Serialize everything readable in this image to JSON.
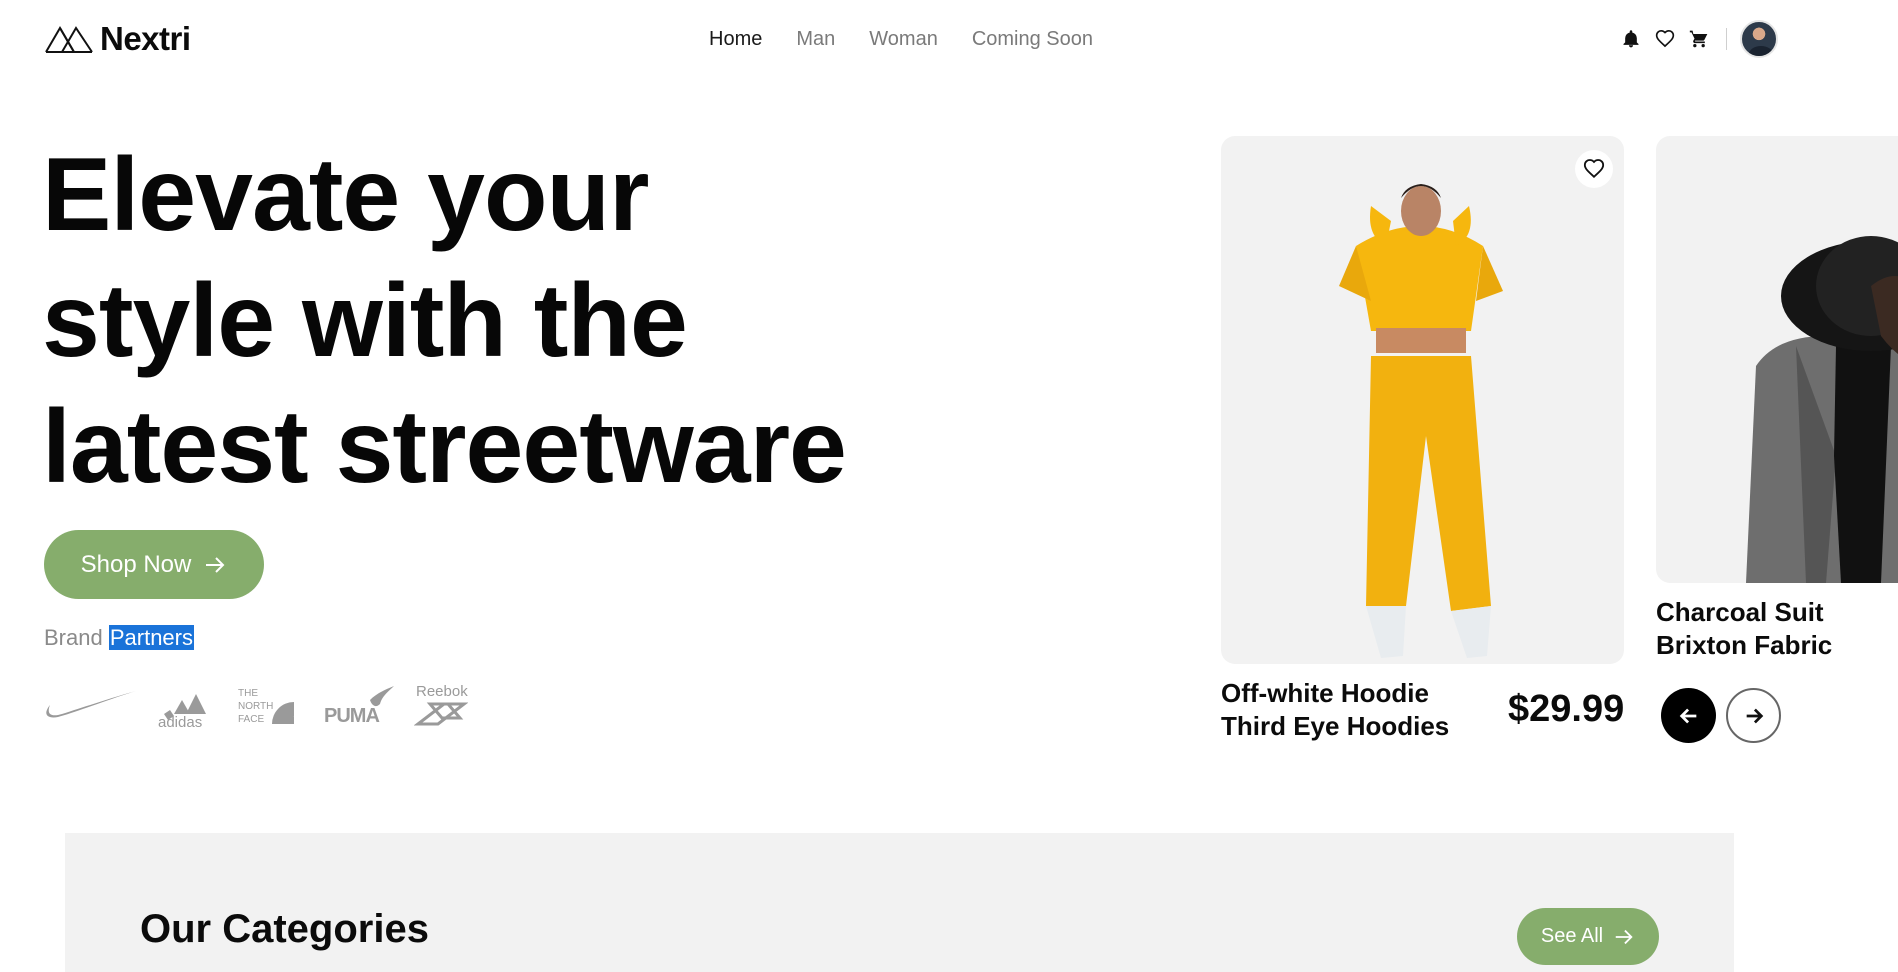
{
  "header": {
    "logo_text": "Nextri",
    "nav": [
      {
        "label": "Home",
        "active": true
      },
      {
        "label": "Man",
        "active": false
      },
      {
        "label": "Woman",
        "active": false
      },
      {
        "label": "Coming Soon",
        "active": false
      }
    ],
    "icons": [
      "bell-icon",
      "heart-icon",
      "cart-icon"
    ]
  },
  "hero": {
    "title_line1": "Elevate your",
    "title_line2": "style with the",
    "title_line3": "latest streetware",
    "cta_label": "Shop Now",
    "brand_label_prefix": "Brand",
    "brand_label_highlight": "Partners",
    "brands": [
      "nike",
      "adidas",
      "THE NORTH FACE",
      "PUMA",
      "Reebok"
    ]
  },
  "products": [
    {
      "name_line1": "Off-white Hoodie",
      "name_line2": "Third Eye Hoodies",
      "price": "$29.99"
    },
    {
      "name_line1": "Charcoal Suit",
      "name_line2": "Brixton Fabric"
    }
  ],
  "categories": {
    "title": "Our Categories",
    "see_all_label": "See All"
  },
  "colors": {
    "accent": "#86ad6c",
    "selection": "#1a73d9",
    "panel": "#f2f2f2"
  }
}
